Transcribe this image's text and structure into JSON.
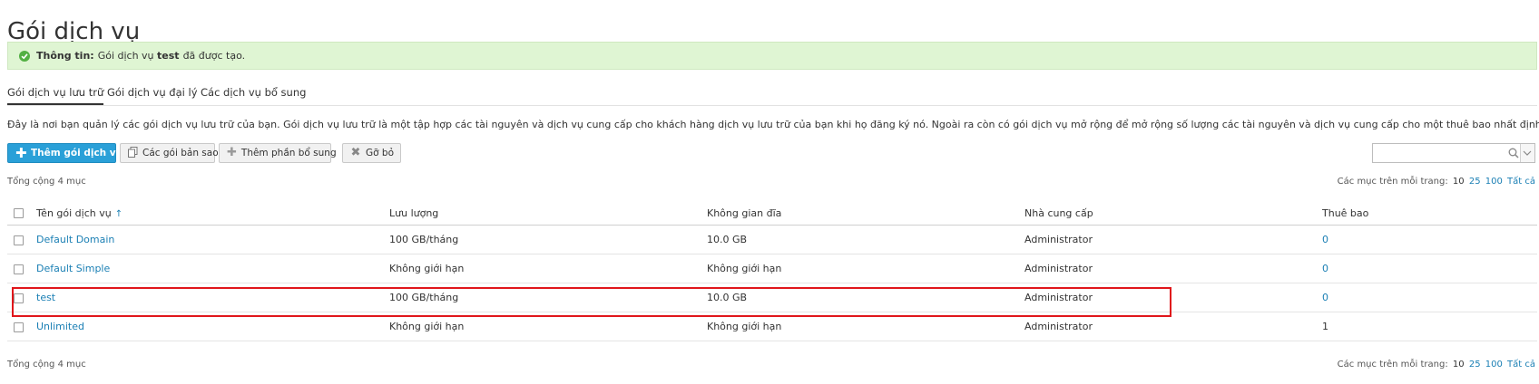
{
  "page": {
    "title": "Gói dịch vụ",
    "message": {
      "label": "Thông tin:",
      "text_before": "Gói dịch vụ",
      "name": "test",
      "text_after": "đã được tạo."
    },
    "tabs": [
      {
        "label": "Gói dịch vụ lưu trữ",
        "active": true
      },
      {
        "label": "Gói dịch vụ đại lý",
        "active": false
      },
      {
        "label": "Các dịch vụ bổ sung",
        "active": false
      }
    ],
    "description": "Đây là nơi bạn quản lý các gói dịch vụ lưu trữ của bạn. Gói dịch vụ lưu trữ là một tập hợp các tài nguyên và dịch vụ cung cấp cho khách hàng dịch vụ lưu trữ của bạn khi họ đăng ký nó. Ngoài ra còn có gói dịch vụ mở rộng để mở rộng số lượng các tài nguyên và dịch vụ cung cấp cho một thuê bao nhất định."
  },
  "toolbar": {
    "add_label": "Thêm gói dịch vụ",
    "copy_label": "Các gói bản sao",
    "addon_label": "Thêm phần bổ sung",
    "remove_label": "Gỡ bỏ"
  },
  "search": {
    "value": "",
    "placeholder": ""
  },
  "list": {
    "total": "Tổng cộng 4 mục",
    "per_page_label": "Các mục trên mỗi trang:",
    "per_page_options": [
      "10",
      "25",
      "100",
      "Tất cả"
    ],
    "columns": [
      "Tên gói dịch vụ",
      "Lưu lượng",
      "Không gian đĩa",
      "Nhà cung cấp",
      "Thuê bao"
    ],
    "sort_indicator": "↑",
    "rows": [
      {
        "name": "Default Domain",
        "traffic": "100 GB/tháng",
        "disk": "10.0 GB",
        "provider": "Administrator",
        "subs": "0",
        "subs_link": true
      },
      {
        "name": "Default Simple",
        "traffic": "Không giới hạn",
        "disk": "Không giới hạn",
        "provider": "Administrator",
        "subs": "0",
        "subs_link": true
      },
      {
        "name": "test",
        "traffic": "100 GB/tháng",
        "disk": "10.0 GB",
        "provider": "Administrator",
        "subs": "0",
        "subs_link": true
      },
      {
        "name": "Unlimited",
        "traffic": "Không giới hạn",
        "disk": "Không giới hạn",
        "provider": "Administrator",
        "subs": "1",
        "subs_link": false
      }
    ]
  },
  "colors": {
    "accent": "#2aa0d8",
    "link": "#1a7fb4",
    "success_bg": "#dff5d3",
    "highlight": "#e0161b"
  },
  "icons": {
    "message": "check-circle-icon",
    "add": "plus-icon",
    "copy": "copy-icon",
    "addon": "addon-icon",
    "remove": "remove-icon",
    "search": "search-icon",
    "dropdown": "chevron-down-icon"
  }
}
